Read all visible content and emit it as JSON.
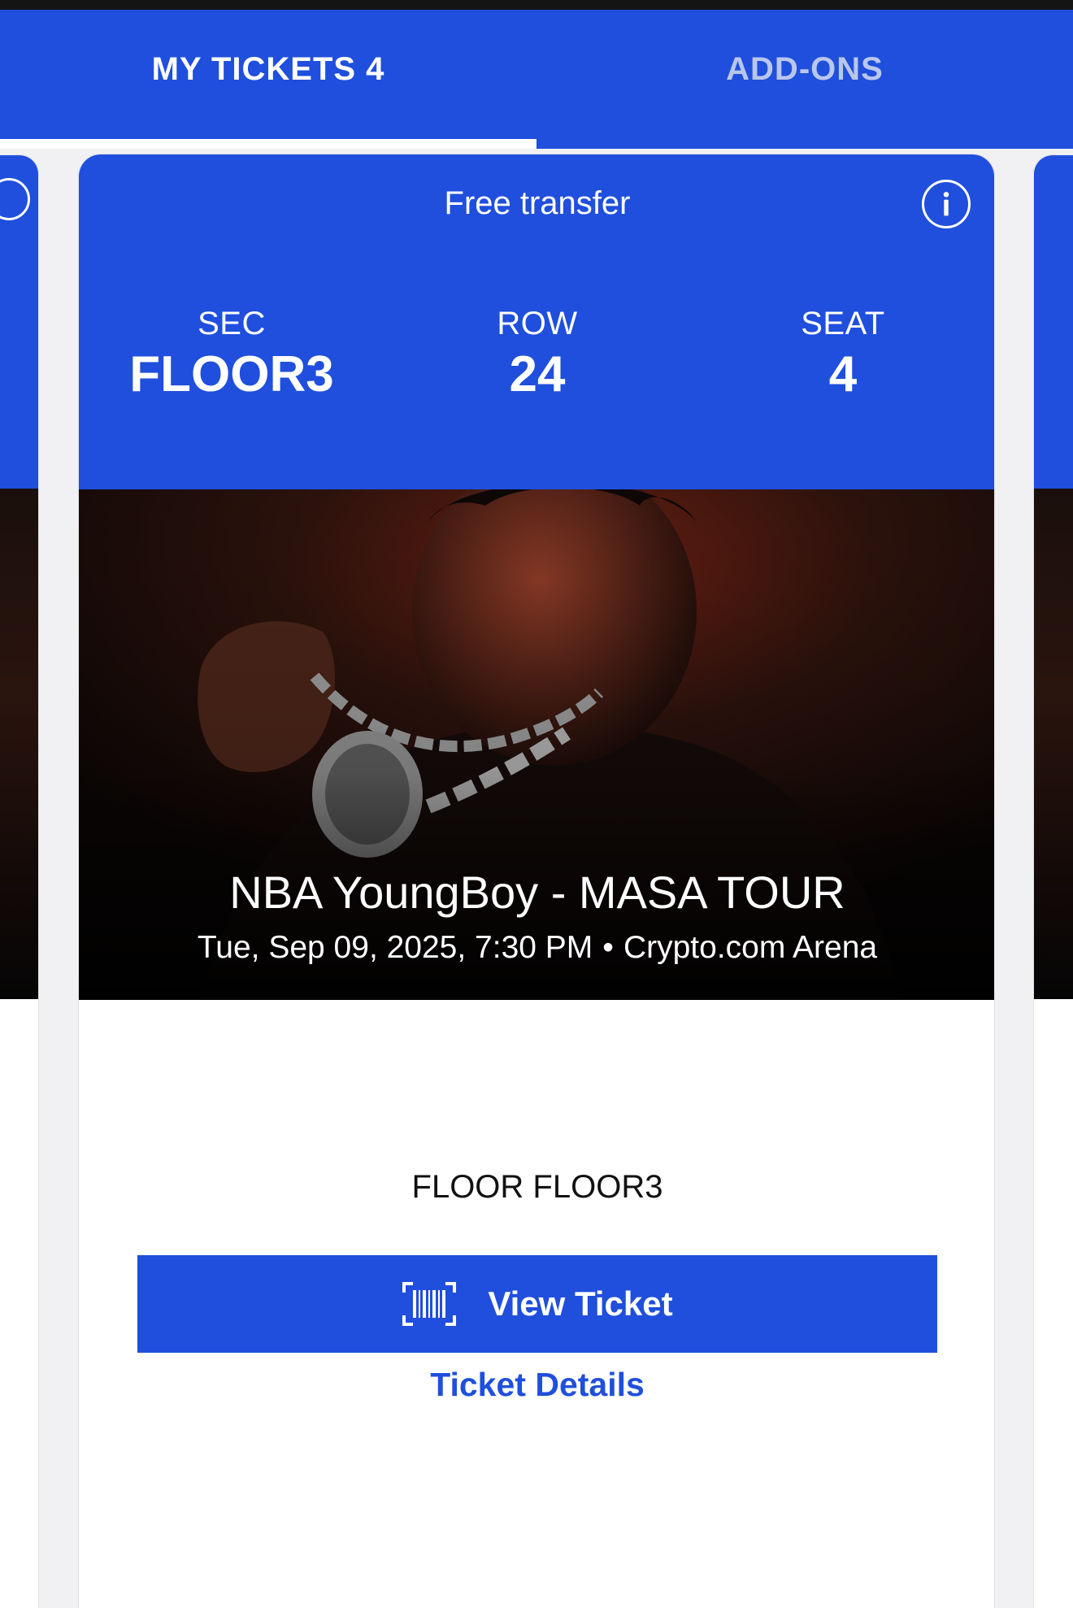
{
  "tabs": [
    {
      "label": "MY TICKETS 4",
      "active": true
    },
    {
      "label": "ADD-ONS",
      "active": false
    }
  ],
  "ticket": {
    "transfer_label": "Free transfer",
    "info_icon": "info-icon",
    "section": {
      "caption": "SEC",
      "value": "FLOOR3"
    },
    "row": {
      "caption": "ROW",
      "value": "24"
    },
    "seat": {
      "caption": "SEAT",
      "value": "4"
    },
    "event": {
      "title": "NBA YoungBoy - MASA TOUR",
      "datetime": "Tue, Sep 09, 2025, 7:30 PM",
      "separator": "•",
      "venue": "Crypto.com Arena"
    },
    "floor_label": "FLOOR FLOOR3",
    "view_ticket_label": "View Ticket",
    "view_ticket_icon": "barcode-icon",
    "details_label": "Ticket Details"
  },
  "colors": {
    "brand_blue": "#1f4fdc",
    "inactive_tab_text": "#b9c6ee",
    "card_bg": "#ffffff",
    "page_bg": "#f1f1f3"
  }
}
